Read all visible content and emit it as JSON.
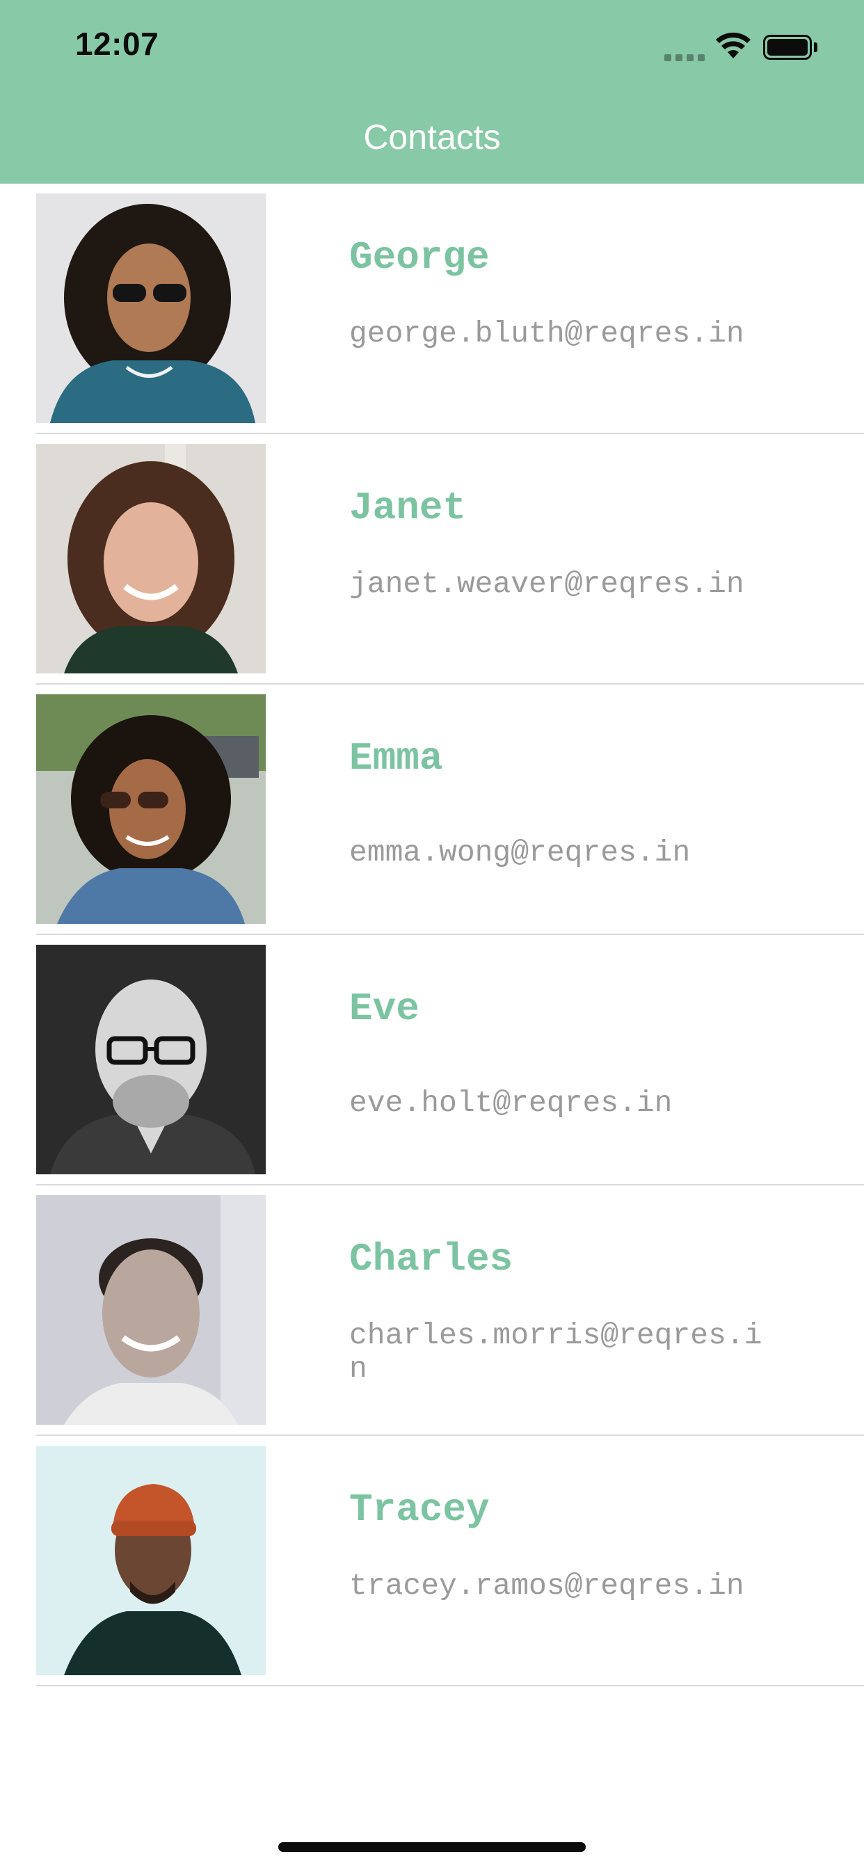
{
  "status_bar": {
    "time": "12:07"
  },
  "nav": {
    "title": "Contacts"
  },
  "colors": {
    "header_background": "#88c9a7",
    "name_accent": "#7cc4a1",
    "email_text": "#9a9a9a"
  },
  "contacts": [
    {
      "name": "George",
      "email": "george.bluth@reqres.in"
    },
    {
      "name": "Janet",
      "email": "janet.weaver@reqres.in"
    },
    {
      "name": "Emma",
      "email": "emma.wong@reqres.in"
    },
    {
      "name": "Eve",
      "email": "eve.holt@reqres.in"
    },
    {
      "name": "Charles",
      "email": "charles.morris@reqres.in"
    },
    {
      "name": "Tracey",
      "email": "tracey.ramos@reqres.in"
    }
  ]
}
